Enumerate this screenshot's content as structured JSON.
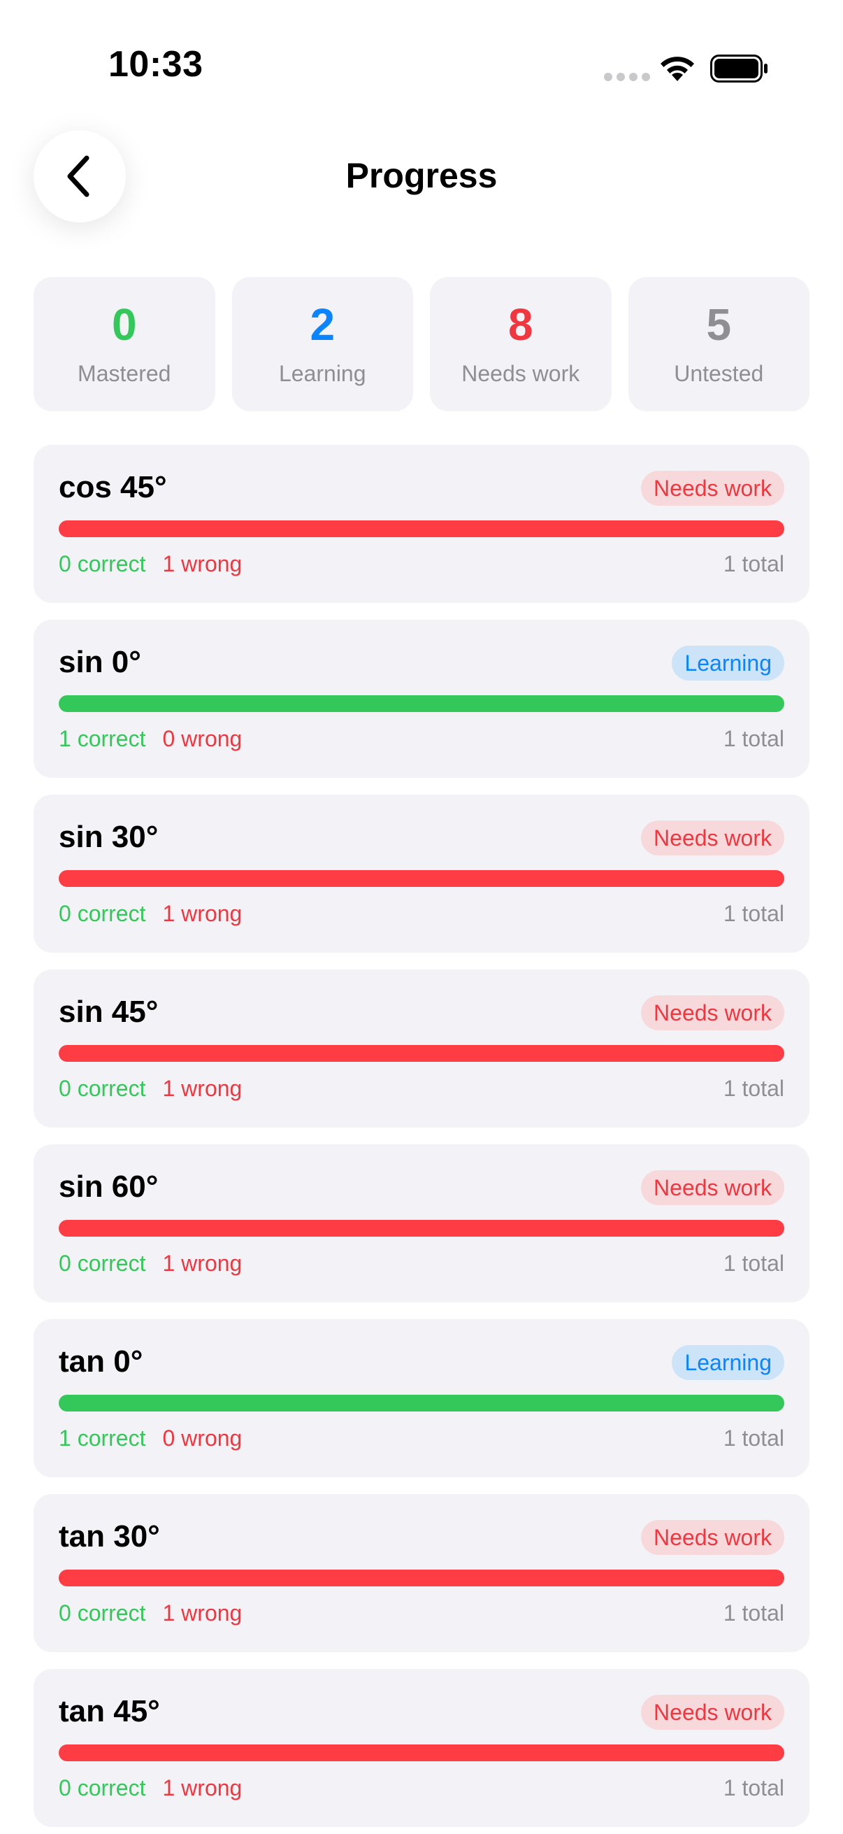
{
  "status_bar": {
    "time": "10:33",
    "icons": [
      "cellular-dots-icon",
      "wifi-icon",
      "battery-icon"
    ]
  },
  "header": {
    "back_icon": "chevron-left-icon",
    "title": "Progress"
  },
  "summary": [
    {
      "count": "0",
      "label": "Mastered",
      "color": "#34c759"
    },
    {
      "count": "2",
      "label": "Learning",
      "color": "#0a84ff"
    },
    {
      "count": "8",
      "label": "Needs work",
      "color": "#f0363f"
    },
    {
      "count": "5",
      "label": "Untested",
      "color": "#8e8e93"
    }
  ],
  "items": [
    {
      "title": "cos 45°",
      "status": "Needs work",
      "status_type": "needs",
      "correct": "0 correct",
      "wrong": "1 wrong",
      "total": "1 total",
      "correct_fraction": 0
    },
    {
      "title": "sin 0°",
      "status": "Learning",
      "status_type": "learning",
      "correct": "1 correct",
      "wrong": "0 wrong",
      "total": "1 total",
      "correct_fraction": 1
    },
    {
      "title": "sin 30°",
      "status": "Needs work",
      "status_type": "needs",
      "correct": "0 correct",
      "wrong": "1 wrong",
      "total": "1 total",
      "correct_fraction": 0
    },
    {
      "title": "sin 45°",
      "status": "Needs work",
      "status_type": "needs",
      "correct": "0 correct",
      "wrong": "1 wrong",
      "total": "1 total",
      "correct_fraction": 0
    },
    {
      "title": "sin 60°",
      "status": "Needs work",
      "status_type": "needs",
      "correct": "0 correct",
      "wrong": "1 wrong",
      "total": "1 total",
      "correct_fraction": 0
    },
    {
      "title": "tan 0°",
      "status": "Learning",
      "status_type": "learning",
      "correct": "1 correct",
      "wrong": "0 wrong",
      "total": "1 total",
      "correct_fraction": 1
    },
    {
      "title": "tan 30°",
      "status": "Needs work",
      "status_type": "needs",
      "correct": "0 correct",
      "wrong": "1 wrong",
      "total": "1 total",
      "correct_fraction": 0
    },
    {
      "title": "tan 45°",
      "status": "Needs work",
      "status_type": "needs",
      "correct": "0 correct",
      "wrong": "1 wrong",
      "total": "1 total",
      "correct_fraction": 0
    }
  ]
}
